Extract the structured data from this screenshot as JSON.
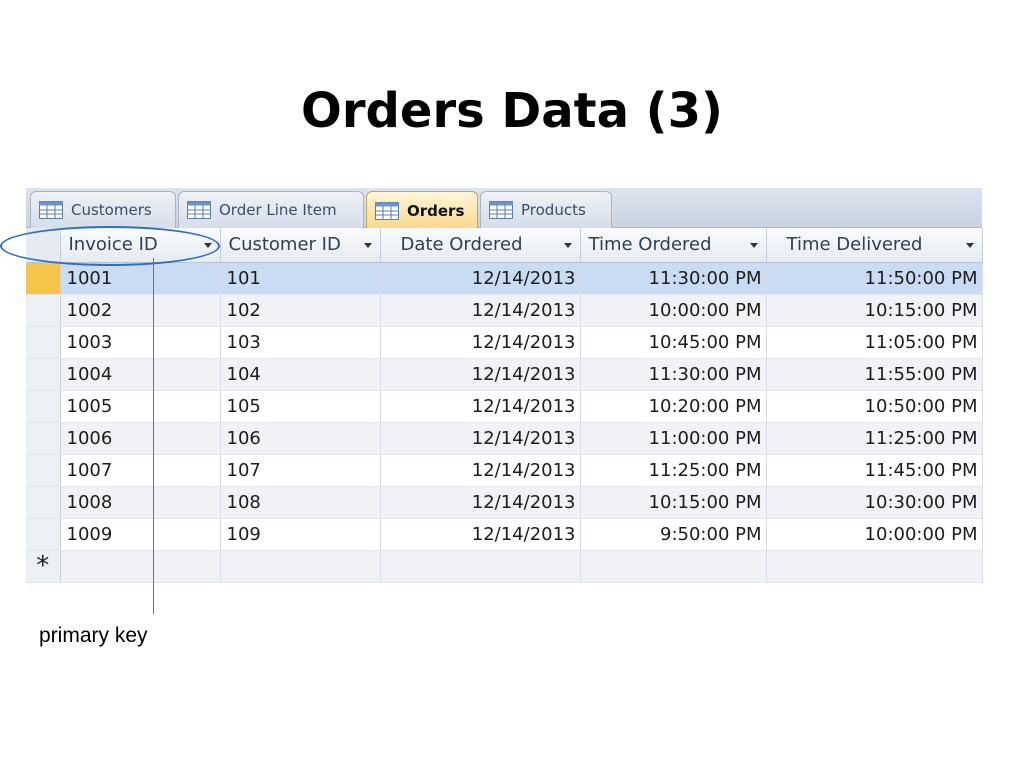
{
  "slide": {
    "title_bold": "Orders",
    "title_rest": " Data (3)"
  },
  "tabs": [
    {
      "label": "Customers",
      "icon": "table-icon"
    },
    {
      "label": "Order Line Item",
      "icon": "table-icon"
    },
    {
      "label": "Orders",
      "icon": "table-icon",
      "active": true
    },
    {
      "label": "Products",
      "icon": "table-icon"
    }
  ],
  "table": {
    "columns": [
      "Invoice ID",
      "Customer ID",
      "Date Ordered",
      "Time Ordered",
      "Time Delivered"
    ],
    "rows": [
      [
        "1001",
        "101",
        "12/14/2013",
        "11:30:00 PM",
        "11:50:00 PM"
      ],
      [
        "1002",
        "102",
        "12/14/2013",
        "10:00:00 PM",
        "10:15:00 PM"
      ],
      [
        "1003",
        "103",
        "12/14/2013",
        "10:45:00 PM",
        "11:05:00 PM"
      ],
      [
        "1004",
        "104",
        "12/14/2013",
        "11:30:00 PM",
        "11:55:00 PM"
      ],
      [
        "1005",
        "105",
        "12/14/2013",
        "10:20:00 PM",
        "10:50:00 PM"
      ],
      [
        "1006",
        "106",
        "12/14/2013",
        "11:00:00 PM",
        "11:25:00 PM"
      ],
      [
        "1007",
        "107",
        "12/14/2013",
        "11:25:00 PM",
        "11:45:00 PM"
      ],
      [
        "1008",
        "108",
        "12/14/2013",
        "10:15:00 PM",
        "10:30:00 PM"
      ],
      [
        "1009",
        "109",
        "12/14/2013",
        "9:50:00 PM",
        "10:00:00 PM"
      ]
    ],
    "new_record_marker": "*",
    "selected_row_color": "#c9dcf4",
    "selector_highlight_color": "#f5c44a"
  },
  "annotation": {
    "label": "primary key",
    "color": "#2e6fc0"
  }
}
